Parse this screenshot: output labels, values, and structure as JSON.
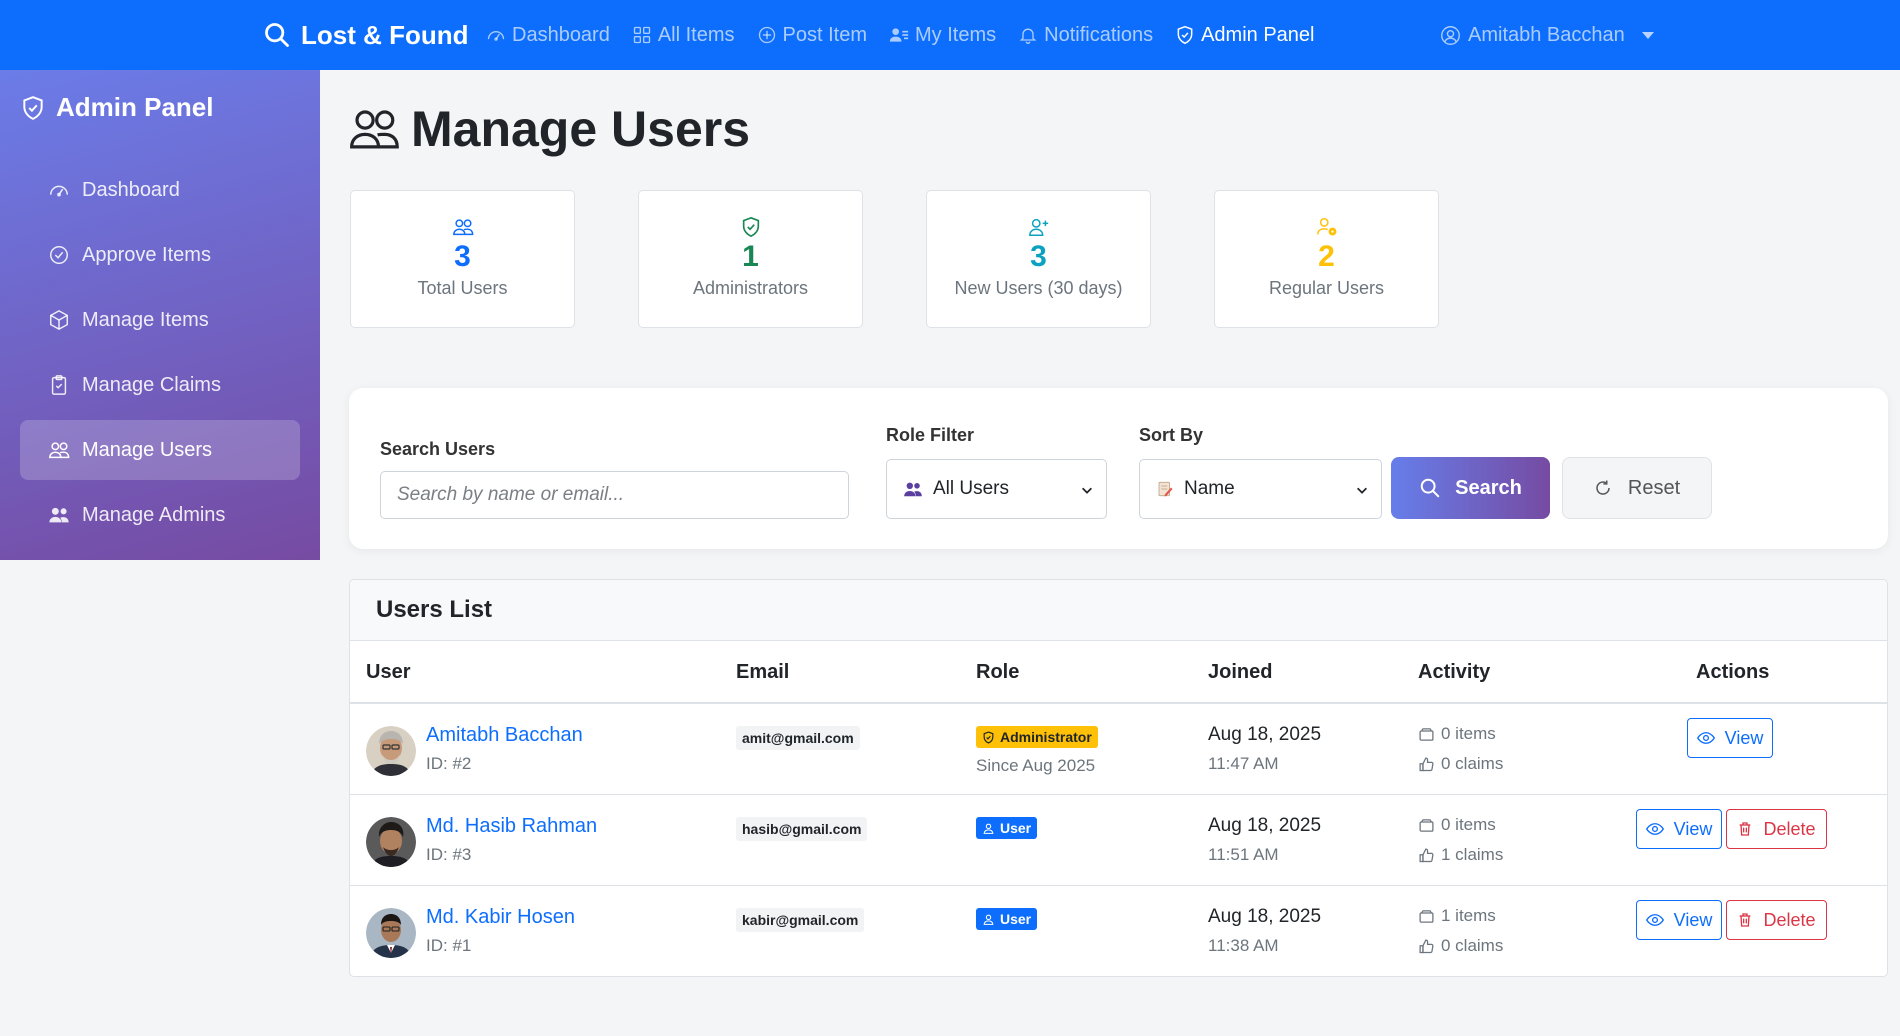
{
  "navbar": {
    "brand": "Lost & Found",
    "links": [
      {
        "label": "Dashboard",
        "icon": "speedometer-icon"
      },
      {
        "label": "All Items",
        "icon": "grid-icon"
      },
      {
        "label": "Post Item",
        "icon": "plus-circle-icon"
      },
      {
        "label": "My Items",
        "icon": "person-lines-icon"
      },
      {
        "label": "Notifications",
        "icon": "bell-icon"
      },
      {
        "label": "Admin Panel",
        "icon": "shield-icon",
        "active": true
      }
    ],
    "user": "Amitabh Bacchan"
  },
  "sidebar": {
    "title": "Admin Panel",
    "items": [
      {
        "label": "Dashboard",
        "icon": "speedometer-icon"
      },
      {
        "label": "Approve Items",
        "icon": "check-circle-icon"
      },
      {
        "label": "Manage Items",
        "icon": "box-icon"
      },
      {
        "label": "Manage Claims",
        "icon": "clipboard-check-icon"
      },
      {
        "label": "Manage Users",
        "icon": "people-icon",
        "active": true
      },
      {
        "label": "Manage Admins",
        "icon": "people-fill-icon"
      }
    ]
  },
  "page": {
    "title": "Manage Users"
  },
  "stats": [
    {
      "value": "3",
      "label": "Total Users",
      "color": "#0d6efd",
      "icon": "people-icon"
    },
    {
      "value": "1",
      "label": "Administrators",
      "color": "#198754",
      "icon": "shield-check-icon"
    },
    {
      "value": "3",
      "label": "New Users (30 days)",
      "color": "#0aa2c0",
      "icon": "person-plus-icon"
    },
    {
      "value": "2",
      "label": "Regular Users",
      "color": "#ffc107",
      "icon": "person-gear-icon"
    }
  ],
  "filters": {
    "search_label": "Search Users",
    "search_placeholder": "Search by name or email...",
    "role_label": "Role Filter",
    "role_value": "All Users",
    "sort_label": "Sort By",
    "sort_value": "Name",
    "search_button": "Search",
    "reset_button": "Reset"
  },
  "users_table": {
    "title": "Users List",
    "headers": [
      "User",
      "Email",
      "Role",
      "Joined",
      "Activity",
      "Actions"
    ],
    "rows": [
      {
        "name": "Amitabh Bacchan",
        "id": "ID: #2",
        "email": "amit@gmail.com",
        "role": "Administrator",
        "since": "Since Aug 2025",
        "joined_date": "Aug 18, 2025",
        "joined_time": "11:47 AM",
        "items": "0 items",
        "claims": "0 claims",
        "view": "View"
      },
      {
        "name": "Md. Hasib Rahman",
        "id": "ID: #3",
        "email": "hasib@gmail.com",
        "role": "User",
        "joined_date": "Aug 18, 2025",
        "joined_time": "11:51 AM",
        "items": "0 items",
        "claims": "1 claims",
        "view": "View",
        "delete": "Delete"
      },
      {
        "name": "Md. Kabir Hosen",
        "id": "ID: #1",
        "email": "kabir@gmail.com",
        "role": "User",
        "joined_date": "Aug 18, 2025",
        "joined_time": "11:38 AM",
        "items": "1 items",
        "claims": "0 claims",
        "view": "View",
        "delete": "Delete"
      }
    ]
  }
}
